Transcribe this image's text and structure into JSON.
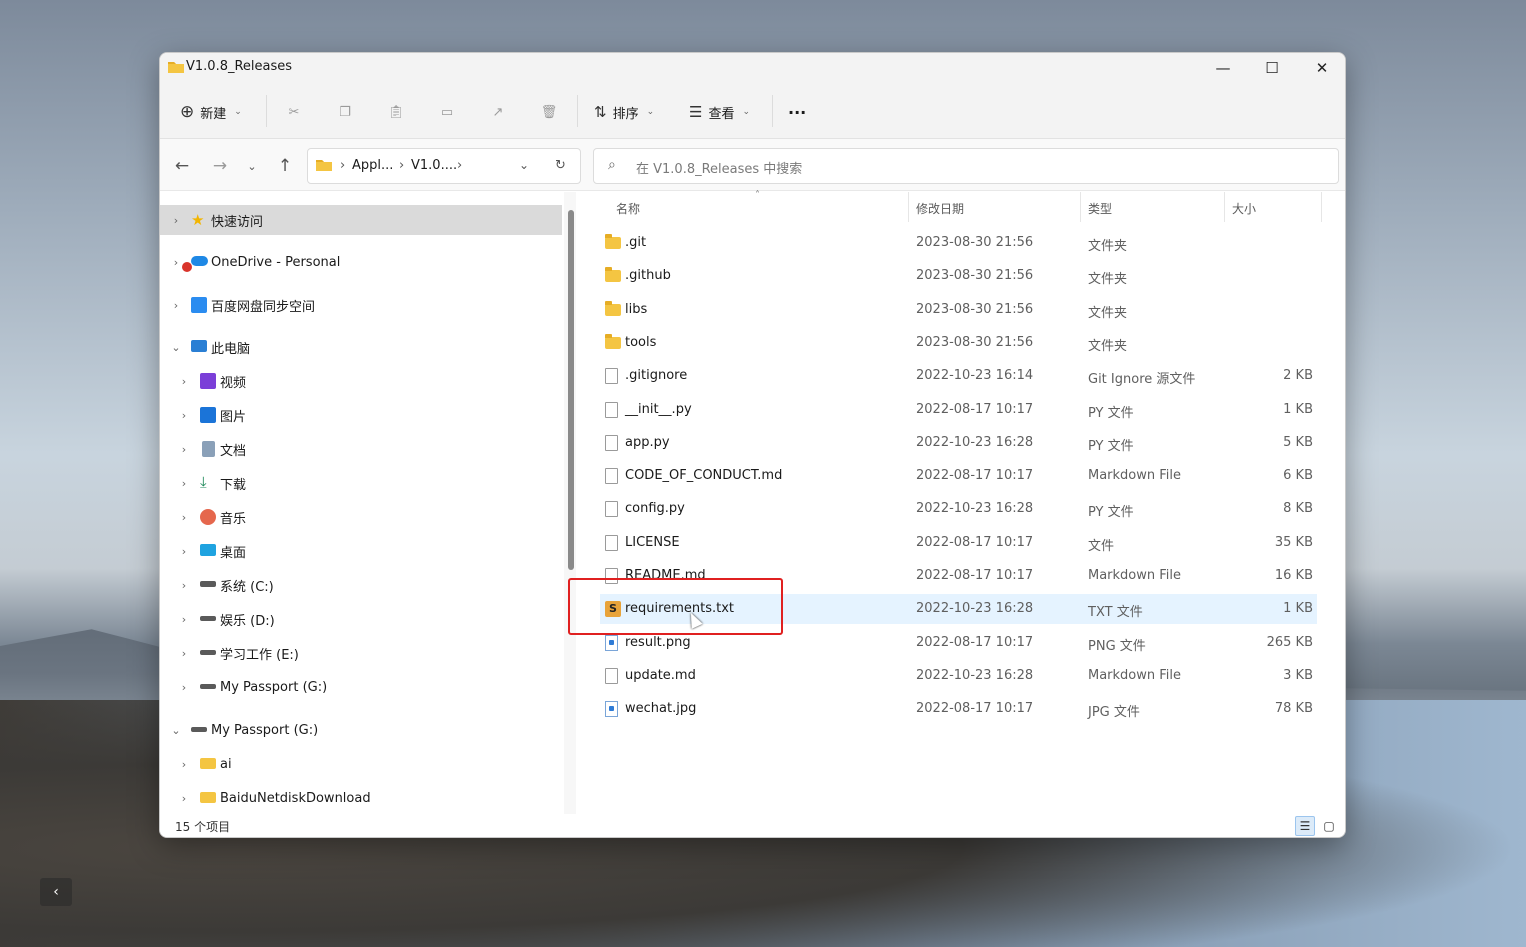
{
  "window": {
    "title": "V1.0.8_Releases"
  },
  "toolbar": {
    "new_label": "新建",
    "sort_label": "排序",
    "view_label": "查看",
    "more_label": "···"
  },
  "address": {
    "crumbs": [
      "Appl...",
      "V1.0...."
    ],
    "search_placeholder": "在 V1.0.8_Releases 中搜索"
  },
  "nav": {
    "items": [
      {
        "label": "快速访问",
        "icon": "star-icon"
      },
      {
        "label": "OneDrive - Personal",
        "icon": "onedrive-icon"
      },
      {
        "label": "百度网盘同步空间",
        "icon": "baidu-netdisk-icon"
      },
      {
        "label": "此电脑",
        "icon": "computer-icon"
      },
      {
        "label": "视频",
        "icon": "video-icon"
      },
      {
        "label": "图片",
        "icon": "pictures-icon"
      },
      {
        "label": "文档",
        "icon": "documents-icon"
      },
      {
        "label": "下载",
        "icon": "download-icon"
      },
      {
        "label": "音乐",
        "icon": "music-icon"
      },
      {
        "label": "桌面",
        "icon": "desktop-icon"
      },
      {
        "label": "系统 (C:)",
        "icon": "drive-c-icon"
      },
      {
        "label": "娱乐 (D:)",
        "icon": "drive-icon"
      },
      {
        "label": "学习工作 (E:)",
        "icon": "drive-icon"
      },
      {
        "label": "My Passport (G:)",
        "icon": "drive-icon"
      },
      {
        "label": "My Passport (G:)",
        "icon": "drive-icon"
      },
      {
        "label": "ai",
        "icon": "folder-icon"
      },
      {
        "label": "BaiduNetdiskDownload",
        "icon": "folder-icon"
      }
    ]
  },
  "columns": {
    "name": "名称",
    "date": "修改日期",
    "type": "类型",
    "size": "大小"
  },
  "files": [
    {
      "name": ".git",
      "date": "2023-08-30 21:56",
      "type": "文件夹",
      "size": "",
      "icon": "folder-icon"
    },
    {
      "name": ".github",
      "date": "2023-08-30 21:56",
      "type": "文件夹",
      "size": "",
      "icon": "folder-icon"
    },
    {
      "name": "libs",
      "date": "2023-08-30 21:56",
      "type": "文件夹",
      "size": "",
      "icon": "folder-icon"
    },
    {
      "name": "tools",
      "date": "2023-08-30 21:56",
      "type": "文件夹",
      "size": "",
      "icon": "folder-icon"
    },
    {
      "name": ".gitignore",
      "date": "2022-10-23 16:14",
      "type": "Git Ignore 源文件",
      "size": "2 KB",
      "icon": "gitignore-file-icon"
    },
    {
      "name": "__init__.py",
      "date": "2022-08-17 10:17",
      "type": "PY 文件",
      "size": "1 KB",
      "icon": "file-icon"
    },
    {
      "name": "app.py",
      "date": "2022-10-23 16:28",
      "type": "PY 文件",
      "size": "5 KB",
      "icon": "file-icon"
    },
    {
      "name": "CODE_OF_CONDUCT.md",
      "date": "2022-08-17 10:17",
      "type": "Markdown File",
      "size": "6 KB",
      "icon": "markdown-file-icon"
    },
    {
      "name": "config.py",
      "date": "2022-10-23 16:28",
      "type": "PY 文件",
      "size": "8 KB",
      "icon": "file-icon"
    },
    {
      "name": "LICENSE",
      "date": "2022-08-17 10:17",
      "type": "文件",
      "size": "35 KB",
      "icon": "file-icon"
    },
    {
      "name": "README.md",
      "date": "2022-08-17 10:17",
      "type": "Markdown File",
      "size": "16 KB",
      "icon": "markdown-file-icon"
    },
    {
      "name": "requirements.txt",
      "date": "2022-10-23 16:28",
      "type": "TXT 文件",
      "size": "1 KB",
      "icon": "sublime-txt-icon"
    },
    {
      "name": "result.png",
      "date": "2022-08-17 10:17",
      "type": "PNG 文件",
      "size": "265 KB",
      "icon": "image-file-icon"
    },
    {
      "name": "update.md",
      "date": "2022-10-23 16:28",
      "type": "Markdown File",
      "size": "3 KB",
      "icon": "markdown-file-icon"
    },
    {
      "name": "wechat.jpg",
      "date": "2022-08-17 10:17",
      "type": "JPG 文件",
      "size": "78 KB",
      "icon": "image-file-icon"
    }
  ],
  "selected_file": "requirements.txt",
  "status": {
    "count_text": "15 个项目"
  },
  "colors": {
    "accent": "#0067c0",
    "selection": "#e5f3ff",
    "highlight_box": "#e02020",
    "folder": "#f4c542"
  }
}
